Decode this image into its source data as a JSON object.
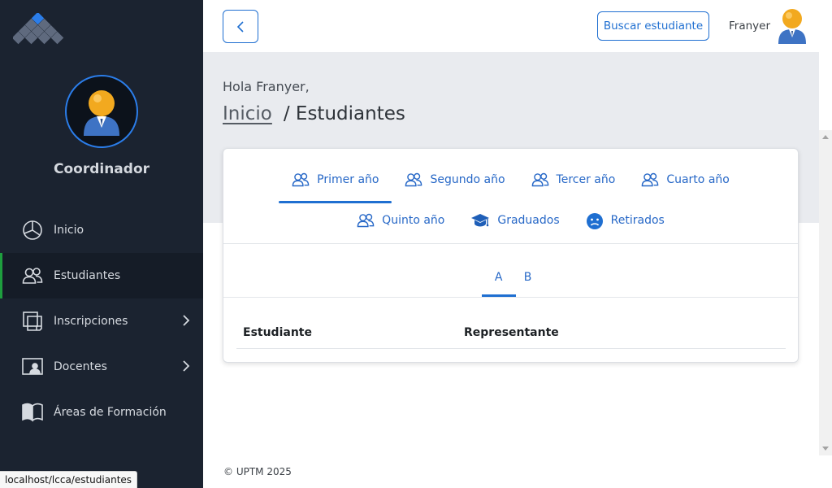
{
  "sidebar": {
    "role": "Coordinador",
    "items": [
      {
        "label": "Inicio",
        "icon": "pie-chart-icon"
      },
      {
        "label": "Estudiantes",
        "icon": "users-icon",
        "active": true
      },
      {
        "label": "Inscripciones",
        "icon": "copy-icon",
        "has_submenu": true
      },
      {
        "label": "Docentes",
        "icon": "teacher-icon",
        "has_submenu": true
      },
      {
        "label": "Áreas de Formación",
        "icon": "book-icon"
      }
    ]
  },
  "topbar": {
    "search_label": "Buscar estudiante",
    "user_name": "Franyer"
  },
  "page": {
    "greeting": "Hola Franyer,",
    "breadcrumb_home": "Inicio",
    "breadcrumb_current": "/ Estudiantes"
  },
  "tabs": [
    {
      "label": "Primer año",
      "icon": "users-icon",
      "active": true
    },
    {
      "label": "Segundo año",
      "icon": "users-icon"
    },
    {
      "label": "Tercer año",
      "icon": "users-icon"
    },
    {
      "label": "Cuarto año",
      "icon": "users-icon"
    },
    {
      "label": "Quinto año",
      "icon": "users-icon"
    },
    {
      "label": "Graduados",
      "icon": "graduation-cap-icon"
    },
    {
      "label": "Retirados",
      "icon": "sad-face-icon"
    }
  ],
  "sections": [
    {
      "label": "A",
      "active": true
    },
    {
      "label": "B"
    }
  ],
  "table": {
    "columns": [
      "Estudiante",
      "Representante"
    ]
  },
  "footer": "© UPTM 2025",
  "status_url": "localhost/lcca/estudiantes",
  "colors": {
    "sidebar_bg": "#1b2330",
    "accent": "#1f6fd1",
    "active_indicator": "#1e9e3e",
    "content_band": "#e9ebef"
  }
}
